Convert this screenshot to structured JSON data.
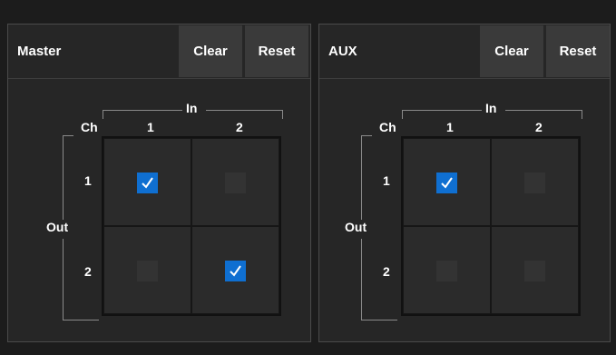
{
  "panels": [
    {
      "title": "Master",
      "clear_label": "Clear",
      "reset_label": "Reset",
      "in_label": "In",
      "ch_label": "Ch",
      "out_label": "Out",
      "in_channels": [
        "1",
        "2"
      ],
      "out_channels": [
        "1",
        "2"
      ],
      "matrix": [
        [
          true,
          false
        ],
        [
          false,
          true
        ]
      ]
    },
    {
      "title": "AUX",
      "clear_label": "Clear",
      "reset_label": "Reset",
      "in_label": "In",
      "ch_label": "Ch",
      "out_label": "Out",
      "in_channels": [
        "1",
        "2"
      ],
      "out_channels": [
        "1",
        "2"
      ],
      "matrix": [
        [
          true,
          false
        ],
        [
          false,
          false
        ]
      ]
    }
  ],
  "colors": {
    "checked": "#0f6fd1",
    "unchecked": "#333333",
    "button": "#3a3a3a",
    "panel": "#262626"
  },
  "icons": {
    "check": "checkmark-icon"
  }
}
